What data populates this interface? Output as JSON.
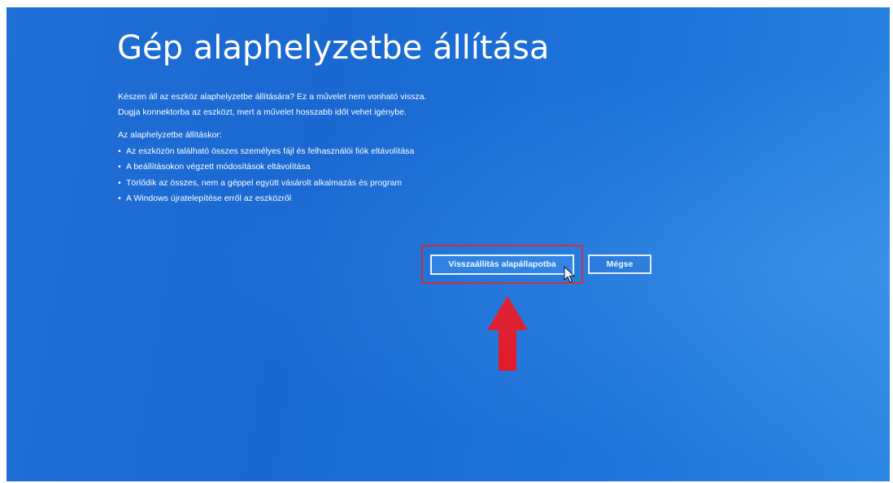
{
  "page": {
    "title": "Gép alaphelyzetbe állítása",
    "intro": [
      "Készen áll az eszköz alaphelyzetbe állítására? Ez a művelet nem vonható vissza.",
      "Dugja konnektorba az eszközt, mert a művelet hosszabb időt vehet igénybe."
    ],
    "list_heading": "Az alaphelyzetbe állításkor:",
    "bullet_symbol": "•",
    "list_items": [
      "Az eszközön található összes személyes fájl és felhasználói fiók eltávolítása",
      "A beállításokon végzett módosítások eltávolítása",
      "Törlődik az összes, nem a géppel együtt vásárolt alkalmazás és program",
      "A Windows újratelepítése erről az eszközről"
    ]
  },
  "buttons": {
    "reset_label": "Visszaállítás alapállapotba",
    "cancel_label": "Mégse"
  },
  "colors": {
    "background": "#1a69d2",
    "text": "#ffffff",
    "highlight_annotation": "#d3202a",
    "arrow_annotation": "#e8101c"
  },
  "icons": {
    "cursor": "mouse-pointer-icon",
    "annotation_arrow": "red-up-arrow-icon"
  }
}
